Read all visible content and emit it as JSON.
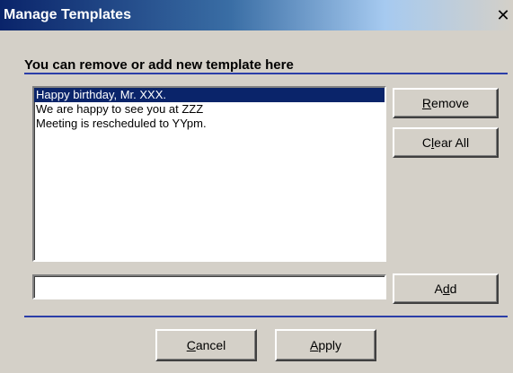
{
  "window": {
    "title": "Manage Templates",
    "close_glyph": "✕"
  },
  "heading": "You can remove or add new template here",
  "templates": [
    {
      "text": "Happy birthday, Mr. XXX.",
      "selected": true
    },
    {
      "text": "We are happy to see you at ZZZ",
      "selected": false
    },
    {
      "text": "Meeting is rescheduled to YYpm.",
      "selected": false
    }
  ],
  "buttons": {
    "remove": {
      "mnemonic": "R",
      "rest": "emove"
    },
    "clear_all": {
      "pre": "C",
      "mnemonic": "l",
      "rest": "ear All"
    },
    "add": {
      "pre": "A",
      "mnemonic": "d",
      "rest": "d"
    },
    "cancel": {
      "mnemonic": "C",
      "rest": "ancel"
    },
    "apply": {
      "mnemonic": "A",
      "rest": "pply"
    }
  },
  "add_input": {
    "value": "",
    "placeholder": ""
  },
  "colors": {
    "selection": "#0a246a",
    "rule": "#2a3da8",
    "title_start": "#0a246a"
  }
}
